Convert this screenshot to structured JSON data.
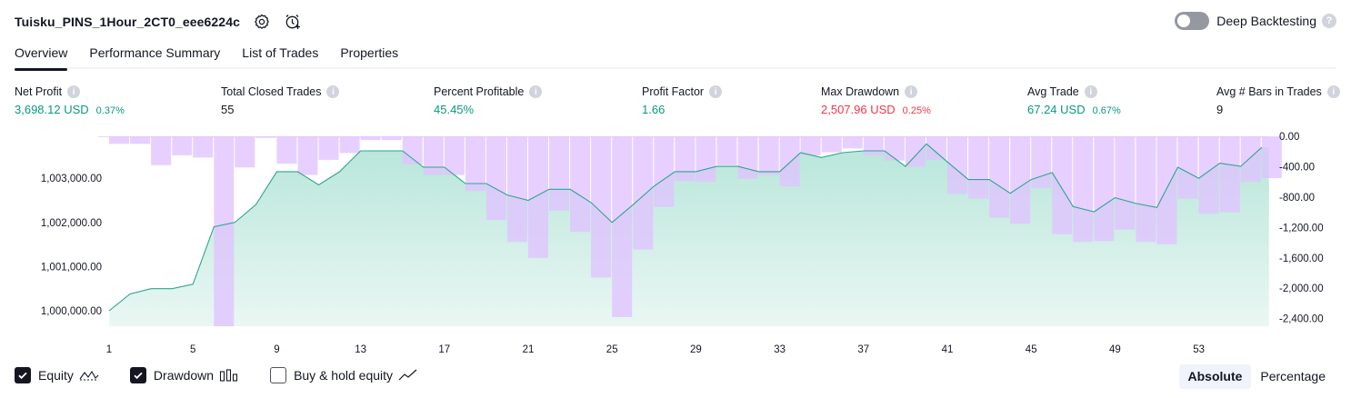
{
  "header": {
    "strategy_name": "Tuisku_PINS_1Hour_2CT0_eee6224c",
    "deep_backtesting_label": "Deep Backtesting",
    "help_glyph": "?"
  },
  "tabs": [
    {
      "label": "Overview",
      "active": true
    },
    {
      "label": "Performance Summary",
      "active": false
    },
    {
      "label": "List of Trades",
      "active": false
    },
    {
      "label": "Properties",
      "active": false
    }
  ],
  "metrics": [
    {
      "label": "Net Profit",
      "value": "3,698.12 USD",
      "pct": "0.37%",
      "color": "#089981"
    },
    {
      "label": "Total Closed Trades",
      "value": "55",
      "pct": "",
      "color": "#131722"
    },
    {
      "label": "Percent Profitable",
      "value": "45.45%",
      "pct": "",
      "color": "#089981"
    },
    {
      "label": "Profit Factor",
      "value": "1.66",
      "pct": "",
      "color": "#089981"
    },
    {
      "label": "Max Drawdown",
      "value": "2,507.96 USD",
      "pct": "0.25%",
      "color": "#f23645"
    },
    {
      "label": "Avg Trade",
      "value": "67.24 USD",
      "pct": "0.67%",
      "color": "#089981"
    },
    {
      "label": "Avg # Bars in Trades",
      "value": "9",
      "pct": "",
      "color": "#131722"
    }
  ],
  "info_glyph": "i",
  "chart_data": {
    "type": "area",
    "x_ticks": [
      "1",
      "5",
      "9",
      "13",
      "17",
      "21",
      "25",
      "29",
      "33",
      "37",
      "41",
      "45",
      "49",
      "53"
    ],
    "left_axis_ticks": [
      "1,000,000.00",
      "1,001,000.00",
      "1,002,000.00",
      "1,003,000.00"
    ],
    "right_axis_ticks": [
      "0.00",
      "-400.00",
      "-800.00",
      "-1,200.00",
      "-1,600.00",
      "-2,000.00",
      "-2,400.00"
    ],
    "left_ylim": [
      999650,
      1003950
    ],
    "right_ylim": [
      -2500,
      0
    ],
    "equity": {
      "name": "Equity",
      "x": [
        1,
        2,
        3,
        4,
        5,
        6,
        7,
        8,
        9,
        10,
        11,
        12,
        13,
        14,
        15,
        16,
        17,
        18,
        19,
        20,
        21,
        22,
        23,
        24,
        25,
        26,
        27,
        28,
        29,
        30,
        31,
        32,
        33,
        34,
        35,
        36,
        37,
        38,
        39,
        40,
        41,
        42,
        43,
        44,
        45,
        46,
        47,
        48,
        49,
        50,
        51,
        52,
        53,
        54,
        55,
        56
      ],
      "values": [
        1000000,
        1000380,
        1000500,
        1000500,
        1000600,
        1001900,
        1002000,
        1002400,
        1003150,
        1003150,
        1002850,
        1003150,
        1003620,
        1003620,
        1003620,
        1003250,
        1003250,
        1002880,
        1002880,
        1002620,
        1002500,
        1002750,
        1002750,
        1002450,
        1002000,
        1002400,
        1002820,
        1003150,
        1003150,
        1003270,
        1003270,
        1003150,
        1003150,
        1003580,
        1003470,
        1003580,
        1003620,
        1003620,
        1003270,
        1003780,
        1003370,
        1002970,
        1002970,
        1002660,
        1002970,
        1003130,
        1002360,
        1002240,
        1002560,
        1002430,
        1002340,
        1003250,
        1003000,
        1003340,
        1003270,
        1003700
      ],
      "color": "#089981"
    },
    "drawdown": {
      "name": "Drawdown",
      "values": [
        -100,
        -100,
        -380,
        -250,
        -280,
        -2500,
        -410,
        -20,
        -360,
        -510,
        -310,
        -220,
        -50,
        -50,
        -370,
        -510,
        -510,
        -720,
        -1100,
        -1390,
        -1600,
        -980,
        -1260,
        -1860,
        -2380,
        -1490,
        -930,
        -590,
        -600,
        -380,
        -560,
        -510,
        -660,
        -250,
        -210,
        -160,
        -250,
        -320,
        -400,
        -310,
        -760,
        -820,
        -1070,
        -1150,
        -680,
        -1290,
        -1390,
        -1380,
        -1230,
        -1390,
        -1420,
        -820,
        -1020,
        -1000,
        -600,
        -550
      ],
      "color": "#e0c3ff"
    },
    "buy_hold": {
      "name": "Buy & hold equity",
      "visible": false
    }
  },
  "legend": {
    "equity_label": "Equity",
    "drawdown_label": "Drawdown",
    "buyhold_label": "Buy & hold equity"
  },
  "mode": {
    "absolute_label": "Absolute",
    "percentage_label": "Percentage"
  }
}
